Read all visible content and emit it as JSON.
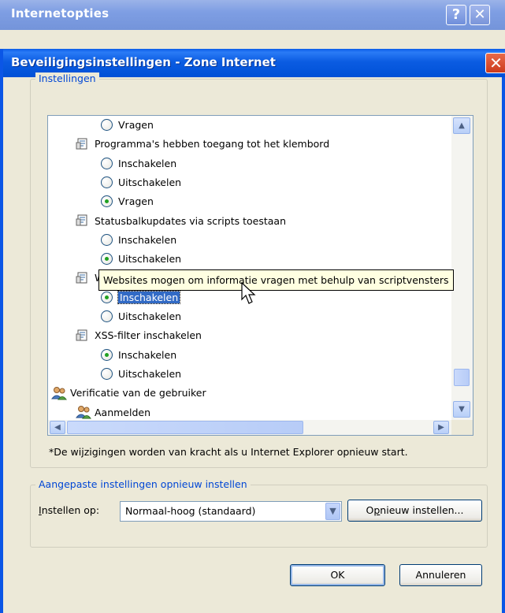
{
  "outer_window": {
    "title": "Internetopties",
    "help_glyph": "?",
    "close_glyph": "✕"
  },
  "dialog": {
    "title": "Beveiligingsinstellingen - Zone Internet",
    "close_glyph": "✕"
  },
  "settings_group": {
    "legend": "Instellingen",
    "rows": [
      {
        "type": "option",
        "label": "Vragen",
        "checked": false
      },
      {
        "type": "setting",
        "label": "Programma's hebben toegang tot het klembord"
      },
      {
        "type": "option",
        "label": "Inschakelen",
        "checked": false
      },
      {
        "type": "option",
        "label": "Uitschakelen",
        "checked": false
      },
      {
        "type": "option",
        "label": "Vragen",
        "checked": true
      },
      {
        "type": "setting",
        "label": "Statusbalkupdates via scripts toestaan"
      },
      {
        "type": "option",
        "label": "Inschakelen",
        "checked": false
      },
      {
        "type": "option",
        "label": "Uitschakelen",
        "checked": true
      },
      {
        "type": "setting",
        "label": "Websites mogen om informatie vragen met behulp van scriptvensters"
      },
      {
        "type": "option",
        "label": "Inschakelen",
        "checked": true,
        "selected": true
      },
      {
        "type": "option",
        "label": "Uitschakelen",
        "checked": false
      },
      {
        "type": "setting",
        "label": "XSS-filter inschakelen"
      },
      {
        "type": "option",
        "label": "Inschakelen",
        "checked": true
      },
      {
        "type": "option",
        "label": "Uitschakelen",
        "checked": false
      },
      {
        "type": "category",
        "label": "Verificatie van de gebruiker"
      },
      {
        "type": "subcategory",
        "label": "Aanmelden"
      }
    ],
    "tooltip": "Websites mogen om informatie vragen met behulp van scriptvensters",
    "note": "*De wijzigingen worden van kracht als u Internet Explorer opnieuw start."
  },
  "reset_group": {
    "legend": "Aangepaste instellingen opnieuw instellen",
    "label": "Instellen op:",
    "label_accesskey": "I",
    "label_rest": "nstellen op:",
    "selected_value": "Normaal-hoog (standaard)",
    "reset_button": "Opnieuw instellen...",
    "reset_accesskey": "p",
    "reset_prefix": "O",
    "reset_rest": "nieuw instellen..."
  },
  "buttons": {
    "ok": "OK",
    "cancel": "Annuleren"
  },
  "colors": {
    "title_blue": "#0B5CE2",
    "legend_blue": "#0046D5",
    "selection_blue": "#316AC5",
    "tooltip_bg": "#FFFFE1"
  }
}
